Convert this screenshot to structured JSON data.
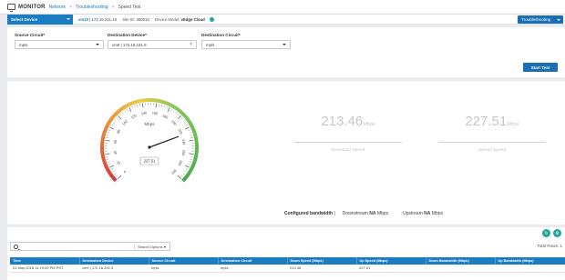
{
  "header": {
    "title": "MONITOR",
    "breadcrumbs": [
      "Network",
      "Troubleshooting",
      "Speed Test"
    ]
  },
  "device_bar": {
    "select_label": "Select Device",
    "device_name": "vm10",
    "device_ip": "172.16.241.16",
    "site_id_label": "Site ID:",
    "site_id": "300010",
    "model_label": "Device Model:",
    "model": "vEdge Cloud",
    "troubleshooting_label": "Troubleshooting"
  },
  "form": {
    "source_circuit_label": "Source Circuit*",
    "source_circuit_value": "mpls",
    "destination_device_label": "Destination Device*",
    "destination_device_value": "vm9 | 172.16.241.9",
    "destination_circuit_label": "Destination Circuit*",
    "destination_circuit_value": "mpls",
    "start_button": "Start Test"
  },
  "gauge": {
    "unit_label": "Mbps",
    "value": 227.51,
    "value_text": "227.51",
    "min": 0,
    "max": 300,
    "ticks": [
      "0",
      "20",
      "40",
      "60",
      "80",
      "100",
      "120",
      "140",
      "160",
      "180",
      "200",
      "220",
      "240",
      "260",
      "280",
      "300"
    ]
  },
  "results": {
    "download_value": "213.46",
    "download_unit": "Mbps",
    "download_caption": "Download Speed",
    "upload_value": "227.51",
    "upload_unit": "Mbps",
    "upload_caption": "Upload Speed"
  },
  "bandwidth": {
    "configured_label": "Configured bandwidth",
    "divider": "|",
    "downstream_label": "Downstream",
    "downstream_value": "NA",
    "downstream_unit": "Mbps",
    "upstream_label": "Upstream",
    "upstream_value": "NA",
    "upstream_unit": "Mbps"
  },
  "table": {
    "search_options_label": "Search Options",
    "total_rows_label": "Total Rows: 1",
    "columns": [
      "Time",
      "Destination Device",
      "Source Circuit",
      "Destination Circuit",
      "Down Speed (Mbps)",
      "Up Speed (Mbps)",
      "Down Bandwidth (Mbps)",
      "Up Bandwidth (Mbps)"
    ],
    "rows": [
      [
        "01 May 2018 11:19:00 PM PST",
        "vm9 | 172.16.241.9",
        "mpls",
        "mpls",
        "213.46",
        "227.51",
        "",
        ""
      ]
    ]
  },
  "colors": {
    "accent": "#1a7dc4",
    "status": "#21a5a0",
    "needle": "#222222"
  }
}
